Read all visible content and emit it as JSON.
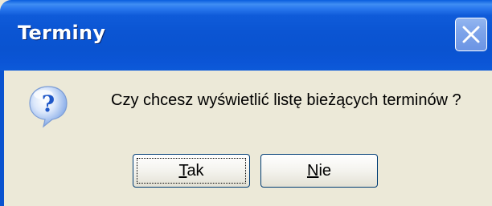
{
  "window": {
    "title": "Terminy",
    "close_icon": "close-icon"
  },
  "dialog": {
    "icon": "question-icon",
    "message": "Czy chcesz wyświetlić listę bieżących terminów ?"
  },
  "buttons": {
    "yes_label": "Tak",
    "no_label": "Nie"
  },
  "colors": {
    "titlebar": "#0a53d0",
    "dialog_bg": "#ece9d8",
    "close_button": "#7ea4ea",
    "icon_blue": "#2e6bd8"
  }
}
